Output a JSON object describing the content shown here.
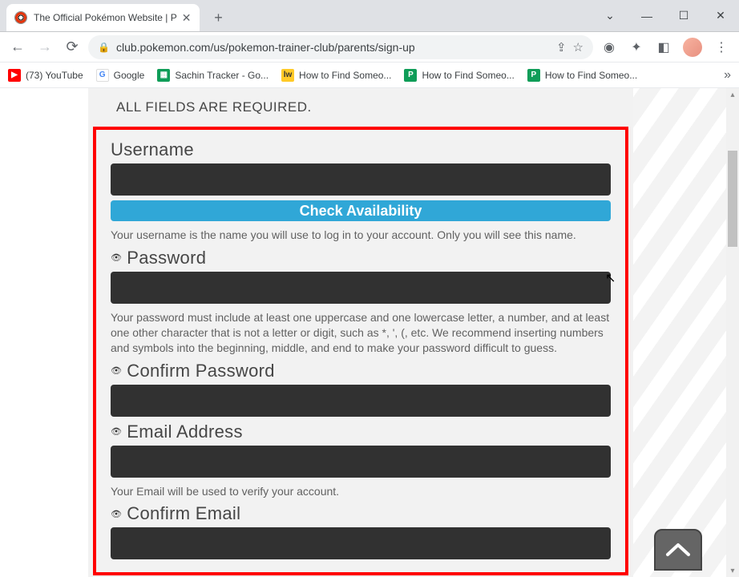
{
  "browser": {
    "tab_title": "The Official Pokémon Website | P",
    "url": "club.pokemon.com/us/pokemon-trainer-club/parents/sign-up",
    "bookmarks": [
      {
        "icon": "yt",
        "label": "(73) YouTube"
      },
      {
        "icon": "g",
        "label": "Google"
      },
      {
        "icon": "sheets",
        "label": "Sachin Tracker - Go..."
      },
      {
        "icon": "lw",
        "label": "How to Find Someo..."
      },
      {
        "icon": "p",
        "label": "How to Find Someo..."
      },
      {
        "icon": "p",
        "label": "How to Find Someo..."
      }
    ]
  },
  "form": {
    "heading": "ALL FIELDS ARE REQUIRED.",
    "username": {
      "label": "Username",
      "value": "",
      "check_button": "Check Availability",
      "help": "Your username is the name you will use to log in to your account. Only you will see this name."
    },
    "password": {
      "label": "Password",
      "value": "",
      "help": "Your password must include at least one uppercase and one lowercase letter, a number, and at least one other character that is not a letter or digit, such as *, ', (, etc. We recommend inserting numbers and symbols into the beginning, middle, and end to make your password difficult to guess."
    },
    "confirm_password": {
      "label": "Confirm Password",
      "value": ""
    },
    "email": {
      "label": "Email Address",
      "value": "",
      "help": "Your Email will be used to verify your account."
    },
    "confirm_email": {
      "label": "Confirm Email",
      "value": ""
    }
  }
}
